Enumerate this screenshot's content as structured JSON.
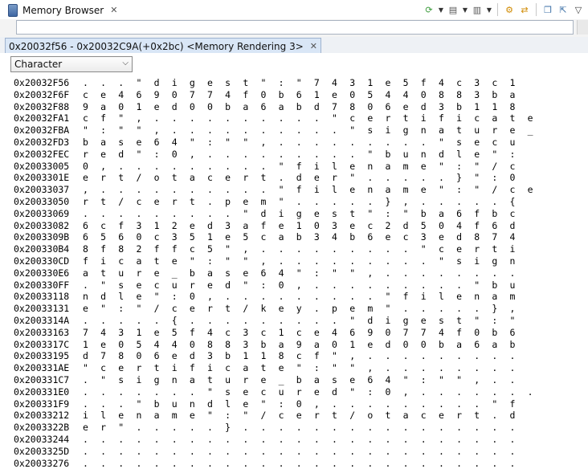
{
  "view_tab": {
    "title": "Memory Browser",
    "close": "✕"
  },
  "toolbar": {
    "buttons": [
      {
        "name": "refresh-icon",
        "glyph": "⟳",
        "color": "#3a9a3a",
        "dropdown": true
      },
      {
        "name": "memory-export-icon",
        "glyph": "▤",
        "color": "#555555",
        "dropdown": true
      },
      {
        "name": "memory-import-icon",
        "glyph": "▥",
        "color": "#555555",
        "dropdown": true
      },
      {
        "name": "link-icon",
        "glyph": "⚙",
        "color": "#d08a00",
        "dropdown": false
      },
      {
        "name": "sync-icon",
        "glyph": "⇄",
        "color": "#d08a00",
        "dropdown": false
      },
      {
        "name": "new-tab-icon",
        "glyph": "❐",
        "color": "#3a6ea5",
        "dropdown": false
      },
      {
        "name": "pin-icon",
        "glyph": "⇱",
        "color": "#3a6ea5",
        "dropdown": false
      },
      {
        "name": "view-menu-icon",
        "glyph": "▽",
        "color": "#444444",
        "dropdown": false
      }
    ]
  },
  "address_input": {
    "value": ""
  },
  "rendering_tab": {
    "label": "0x20032f56 - 0x20032C9A(+0x2bc) <Memory Rendering 3>",
    "close": "✕"
  },
  "format_select": {
    "value": "Character",
    "options": [
      "Character"
    ]
  },
  "rows": [
    {
      "addr": "0x20032F56",
      "chars": ". . . \" d i g e s t \" : \" 7 4 3 1 e 5 f 4 c 3 c 1"
    },
    {
      "addr": "0x20032F6F",
      "chars": "c e 4 6 9 0 7 7 4 f 0 b 6 1 e 0 5 4 4 0 8 8 3 b a"
    },
    {
      "addr": "0x20032F88",
      "chars": "9 a 0 1 e d 0 0 b a 6 a b d 7 8 0 6 e d 3 b 1 1 8"
    },
    {
      "addr": "0x20032FA1",
      "chars": "c f \" , . . . . . . . . . . \" c e r t i f i c a t e"
    },
    {
      "addr": "0x20032FBA",
      "chars": "\" : \" \" , . . . . . . . . . . \" s i g n a t u r e _"
    },
    {
      "addr": "0x20032FD3",
      "chars": "b a s e 6 4 \" : \" \" , . . . . . . . . . \" s e c u"
    },
    {
      "addr": "0x20032FEC",
      "chars": "r e d \" : 0 , . . . . . . . . . \" b u n d l e \" :"
    },
    {
      "addr": "0x20033005",
      "chars": "0 , . . . . . . . . . \" f i l e n a m e \" : \" / c"
    },
    {
      "addr": "0x2003301E",
      "chars": "e r t / o t a c e r t . d e r \" . . . . . } \" : 0"
    },
    {
      "addr": "0x20033037",
      "chars": ", . . . . . . . . . . \" f i l e n a m e \" : \" / c e"
    },
    {
      "addr": "0x20033050",
      "chars": "r t / c e r t . p e m \" . . . . . } , . . . . . {"
    },
    {
      "addr": "0x20033069",
      "chars": ". . . . . . . . . \" d i g e s t \" : \" b a 6 f b c"
    },
    {
      "addr": "0x20033082",
      "chars": "6 c f 3 1 2 e d 3 a f e 1 0 3 e c 2 d 5 0 4 f 6 d"
    },
    {
      "addr": "0x2003309B",
      "chars": "6 5 6 0 c 3 5 1 e 5 c a b 3 4 b 6 e c 3 e d 8 7 4"
    },
    {
      "addr": "0x200330B4",
      "chars": "8 f 8 2 f f c 5 \" , . . . . . . . . . \" c e r t i"
    },
    {
      "addr": "0x200330CD",
      "chars": "f i c a t e \" : \" \" , . . . . . . . . . \" s i g n"
    },
    {
      "addr": "0x200330E6",
      "chars": "a t u r e _ b a s e 6 4 \" : \" \" , . . . . . . . ."
    },
    {
      "addr": "0x200330FF",
      "chars": ". \" s e c u r e d \" : 0 , . . . . . . . . . \" b u"
    },
    {
      "addr": "0x20033118",
      "chars": "n d l e \" : 0 , . . . . . . . . . \" f i l e n a m"
    },
    {
      "addr": "0x20033131",
      "chars": "e \" : \" / c e r t / k e y . p e m \" . . . . . } ,"
    },
    {
      "addr": "0x2003314A",
      "chars": ". . . . . { . . . . . . . . . \" d i g e s t \" : \""
    },
    {
      "addr": "0x20033163",
      "chars": "7 4 3 1 e 5 f 4 c 3 c 1 c e 4 6 9 0 7 7 4 f 0 b 6"
    },
    {
      "addr": "0x2003317C",
      "chars": "1 e 0 5 4 4 0 8 8 3 b a 9 a 0 1 e d 0 0 b a 6 a b"
    },
    {
      "addr": "0x20033195",
      "chars": "d 7 8 0 6 e d 3 b 1 1 8 c f \" , . . . . . . . . ."
    },
    {
      "addr": "0x200331AE",
      "chars": "\" c e r t i f i c a t e \" : \" \" , . . . . . . . ."
    },
    {
      "addr": "0x200331C7",
      "chars": ". \" s i g n a t u r e _ b a s e 6 4 \" : \" \" , . ."
    },
    {
      "addr": "0x200331E0",
      "chars": ". . . . . . . \" s e c u r e d \" : 0 , . . . . . . ."
    },
    {
      "addr": "0x200331F9",
      "chars": ". . . \" b u n d l e \" : 0 , . . . . . . . . . \" f"
    },
    {
      "addr": "0x20033212",
      "chars": "i l e n a m e \" : \" / c e r t / o t a c e r t . d"
    },
    {
      "addr": "0x2003322B",
      "chars": "e r \" . . . . . } . . . . . . . . . . . . . . . ."
    },
    {
      "addr": "0x20033244",
      "chars": ". . . . . . . . . . . . . . . . . . . . . . . . ."
    },
    {
      "addr": "0x2003325D",
      "chars": ". . . . . . . . . . . . . . . . . . . . . . . . ."
    },
    {
      "addr": "0x20033276",
      "chars": ". . . . . . . . . . . . . . . . . . . . . . . . ."
    }
  ]
}
